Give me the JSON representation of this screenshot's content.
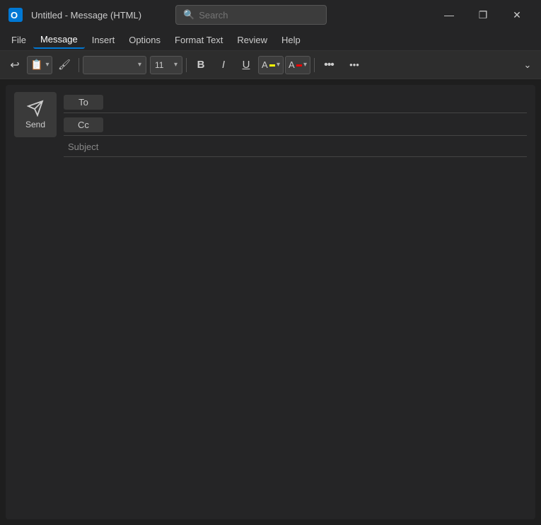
{
  "titlebar": {
    "app_name": "Untitled",
    "separator": " - ",
    "window_title": "Message (HTML)",
    "search_placeholder": "Search"
  },
  "window_controls": {
    "minimize": "—",
    "maximize": "❐",
    "close": "✕"
  },
  "menubar": {
    "items": [
      {
        "id": "file",
        "label": "File"
      },
      {
        "id": "message",
        "label": "Message",
        "active": true
      },
      {
        "id": "insert",
        "label": "Insert"
      },
      {
        "id": "options",
        "label": "Options"
      },
      {
        "id": "format_text",
        "label": "Format Text"
      },
      {
        "id": "review",
        "label": "Review"
      },
      {
        "id": "help",
        "label": "Help"
      }
    ]
  },
  "toolbar": {
    "undo_label": "↩",
    "clipboard_label": "📋",
    "paste_label": "📌",
    "font_name": "",
    "font_size": "11",
    "bold": "B",
    "italic": "I",
    "underline": "U",
    "highlight_label": "A",
    "font_color_label": "A",
    "more_label": "•••",
    "overflow_label": "•••",
    "expand_label": "⌄"
  },
  "compose": {
    "send_button_label": "Send",
    "to_label": "To",
    "cc_label": "Cc",
    "subject_label": "Subject",
    "to_value": "",
    "cc_value": "",
    "subject_value": "",
    "body_value": ""
  }
}
